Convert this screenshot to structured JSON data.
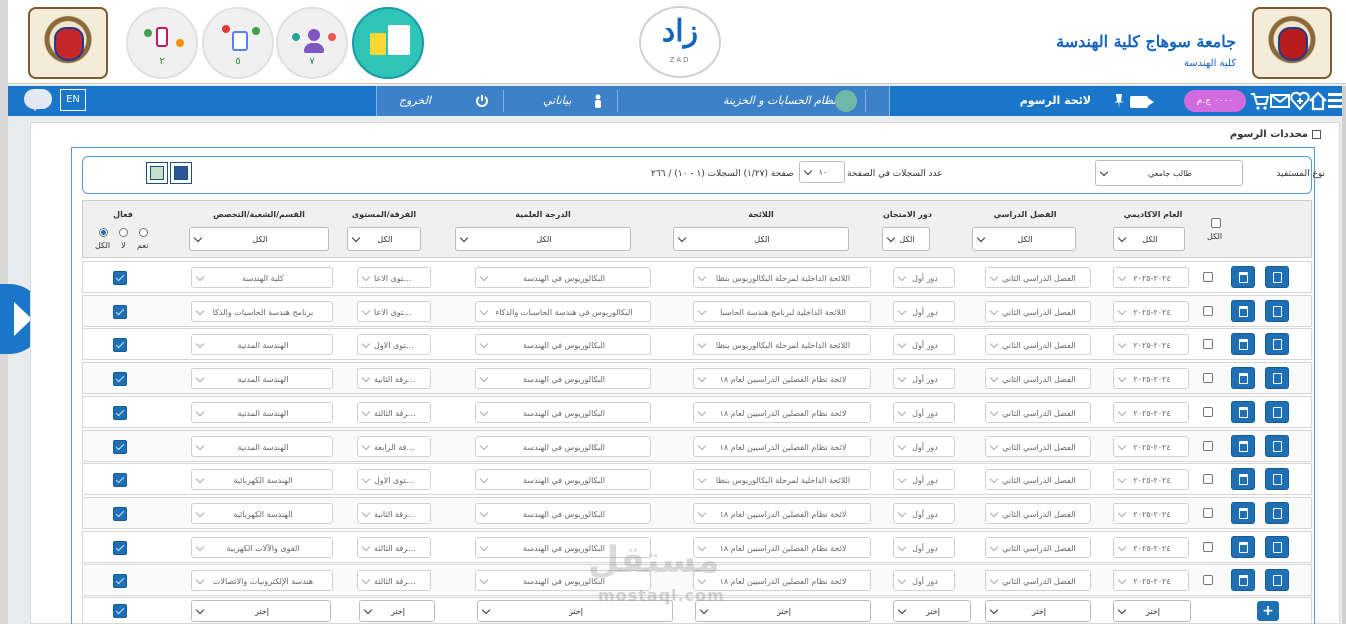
{
  "header": {
    "university_title": "جامعة سوهاج كلية الهندسة",
    "university_subtitle": "كلية الهندسة",
    "logo_text": "زاد",
    "logo_small": "ZAD",
    "circle_numbers": [
      "٢",
      "٥",
      "٧"
    ]
  },
  "navbar": {
    "lang": "EN",
    "menu": {
      "accounts": "نظام الحسابات و الخزينة",
      "mydata": "بياناتي",
      "logout": "الخروج"
    },
    "page_title": "لائحة الرسوم",
    "cart_badge": "٠٠٠٠ ج.م"
  },
  "panel": {
    "title": "محددات الرسوم"
  },
  "filter": {
    "beneficiary_label": "نوع المستفيد",
    "beneficiary_value": "طالب جامعي",
    "per_page_label": "عدد السجلات في الصفحة",
    "per_page_value": "١٠",
    "paging_text": "صفحة (١/٢٧) السجلات (١ - ١٠) / ٢٦٦"
  },
  "columns": {
    "all": "الكل",
    "year": "العام الاكاديمي",
    "semester": "الفصل الدراسي",
    "exam_round": "دور الامتحان",
    "regulation": "اللائحة",
    "degree": "الدرجة العلمية",
    "level": "الفرقة/المستوى",
    "dept": "القسم/الشعبة/التخصص",
    "active": "فعال",
    "active_yes": "نعم",
    "active_no": "لا",
    "active_all": "الكل"
  },
  "header_filters": {
    "year": "الكل",
    "semester": "الكل",
    "exam_round": "الكل",
    "regulation": "الكل",
    "degree": "الكل",
    "level": "الكل",
    "dept": "الكل"
  },
  "rows": [
    {
      "year": "٢٠٢٤-٢٠٢٥",
      "semester": "الفصل الدراسي الثاني",
      "exam": "دور أول",
      "regulation": "اللائحة الداخلية لمرحلة البكالوريوس بنظا",
      "degree": "البكالوريوس في الهندسة",
      "level": "المستوى الاعا",
      "dept": "كلية الهندسة"
    },
    {
      "year": "٢٠٢٤-٢٠٢٥",
      "semester": "الفصل الدراسي الثاني",
      "exam": "دور أول",
      "regulation": "اللائحة الداخلية لبرنامج هندسة الحاسبا",
      "degree": "البكالوريوس في هندسة الحاسبات والذكاء",
      "level": "المستوى الاعا",
      "dept": "برنامج هندسة الحاسبات والذكا"
    },
    {
      "year": "٢٠٢٤-٢٠٢٥",
      "semester": "الفصل الدراسي الثاني",
      "exam": "دور أول",
      "regulation": "اللائحة الداخلية لمرحلة البكالوريوس بنظا",
      "degree": "البكالوريوس في الهندسة",
      "level": "المستوى الاول",
      "dept": "الهندسة المدنية"
    },
    {
      "year": "٢٠٢٤-٢٠٢٥",
      "semester": "الفصل الدراسي الثاني",
      "exam": "دور أول",
      "regulation": "لائحة نظام الفصلين الدراسيين لعام ١٨",
      "degree": "البكالوريوس في الهندسة",
      "level": "الفرقة الثانية",
      "dept": "الهندسة المدنية"
    },
    {
      "year": "٢٠٢٤-٢٠٢٥",
      "semester": "الفصل الدراسي الثاني",
      "exam": "دور أول",
      "regulation": "لائحة نظام الفصلين الدراسيين لعام ١٨",
      "degree": "البكالوريوس في الهندسة",
      "level": "الفرقة الثالثة",
      "dept": "الهندسة المدنية"
    },
    {
      "year": "٢٠٢٤-٢٠٢٥",
      "semester": "الفصل الدراسي الثاني",
      "exam": "دور أول",
      "regulation": "لائحة نظام الفصلين الدراسيين لعام ١٨",
      "degree": "البكالوريوس في الهندسة",
      "level": "الفرقة الرابعة",
      "dept": "الهندسة المدنية"
    },
    {
      "year": "٢٠٢٤-٢٠٢٥",
      "semester": "الفصل الدراسي الثاني",
      "exam": "دور أول",
      "regulation": "اللائحة الداخلية لمرحلة البكالوريوس بنظا",
      "degree": "البكالوريوس في الهندسة",
      "level": "المستوى الاول",
      "dept": "الهندسة الكهربائية"
    },
    {
      "year": "٢٠٢٤-٢٠٢٥",
      "semester": "الفصل الدراسي الثاني",
      "exam": "دور أول",
      "regulation": "لائحة نظام الفصلين الدراسيين لعام ١٨",
      "degree": "البكالوريوس في الهندسة",
      "level": "الفرقة الثانية",
      "dept": "الهندسة الكهربائية"
    },
    {
      "year": "٢٠٢٤-٢٠٢٥",
      "semester": "الفصل الدراسي الثاني",
      "exam": "دور أول",
      "regulation": "لائحة نظام الفصلين الدراسيين لعام ١٨",
      "degree": "البكالوريوس في الهندسة",
      "level": "الفرقة الثالثة",
      "dept": "القوى والآلات الكهربية"
    },
    {
      "year": "٢٠٢٤-٢٠٢٥",
      "semester": "الفصل الدراسي الثاني",
      "exam": "دور أول",
      "regulation": "لائحة نظام الفصلين الدراسيين لعام ١٨",
      "degree": "البكالوريوس في الهندسة",
      "level": "الفرقة الثالثة",
      "dept": "هندسة الإلكترونيات والاتصالات"
    }
  ],
  "new_row": {
    "placeholder": "إختر"
  },
  "watermark": {
    "arabic": "مستقل",
    "latin": "mostaql.com"
  },
  "colors": {
    "primary": "#1976c9",
    "button": "#1f6fb5",
    "badge": "#d26be0"
  }
}
